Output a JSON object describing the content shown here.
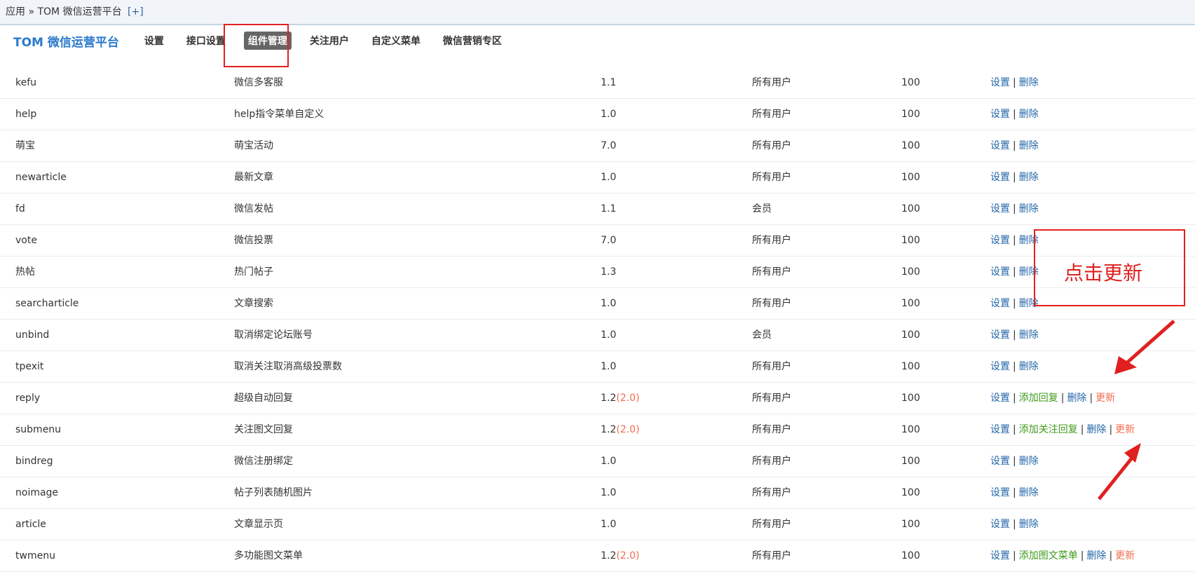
{
  "breadcrumb": {
    "app": "应用",
    "sep": "»",
    "platform": "TOM 微信运营平台",
    "add": "[+]"
  },
  "tabs": {
    "title": "TOM 微信运营平台",
    "items": [
      "设置",
      "接口设置",
      "组件管理",
      "关注用户",
      "自定义菜单",
      "微信营销专区"
    ],
    "active_index": 2
  },
  "annotation": {
    "note": "点击更新",
    "color": "#e02020"
  },
  "colors": {
    "link": "#2366a8",
    "green_link": "#3f9a1b",
    "orange": "#f26c4f",
    "title_blue": "#2b7acd"
  },
  "rows": [
    {
      "id": "kefu",
      "name": "微信多客服",
      "ver": "1.1",
      "ver_update": "",
      "role": "所有用户",
      "num": "100",
      "actions": [
        "设置",
        "删除"
      ]
    },
    {
      "id": "help",
      "name": "help指令菜单自定义",
      "ver": "1.0",
      "ver_update": "",
      "role": "所有用户",
      "num": "100",
      "actions": [
        "设置",
        "删除"
      ]
    },
    {
      "id": "萌宝",
      "name": "萌宝活动",
      "ver": "7.0",
      "ver_update": "",
      "role": "所有用户",
      "num": "100",
      "actions": [
        "设置",
        "删除"
      ]
    },
    {
      "id": "newarticle",
      "name": "最新文章",
      "ver": "1.0",
      "ver_update": "",
      "role": "所有用户",
      "num": "100",
      "actions": [
        "设置",
        "删除"
      ]
    },
    {
      "id": "fd",
      "name": "微信发帖",
      "ver": "1.1",
      "ver_update": "",
      "role": "会员",
      "num": "100",
      "actions": [
        "设置",
        "删除"
      ]
    },
    {
      "id": "vote",
      "name": "微信投票",
      "ver": "7.0",
      "ver_update": "",
      "role": "所有用户",
      "num": "100",
      "actions": [
        "设置",
        "删除"
      ]
    },
    {
      "id": "热帖",
      "name": "热门帖子",
      "ver": "1.3",
      "ver_update": "",
      "role": "所有用户",
      "num": "100",
      "actions": [
        "设置",
        "删除"
      ]
    },
    {
      "id": "searcharticle",
      "name": "文章搜索",
      "ver": "1.0",
      "ver_update": "",
      "role": "所有用户",
      "num": "100",
      "actions": [
        "设置",
        "删除"
      ]
    },
    {
      "id": "unbind",
      "name": "取消绑定论坛账号",
      "ver": "1.0",
      "ver_update": "",
      "role": "会员",
      "num": "100",
      "actions": [
        "设置",
        "删除"
      ]
    },
    {
      "id": "tpexit",
      "name": "取消关注取消高级投票数",
      "ver": "1.0",
      "ver_update": "",
      "role": "所有用户",
      "num": "100",
      "actions": [
        "设置",
        "删除"
      ]
    },
    {
      "id": "reply",
      "name": "超级自动回复",
      "ver": "1.2",
      "ver_update": "(2.0)",
      "role": "所有用户",
      "num": "100",
      "actions": [
        "设置",
        "添加回复",
        "删除",
        "更新"
      ]
    },
    {
      "id": "submenu",
      "name": "关注图文回复",
      "ver": "1.2",
      "ver_update": "(2.0)",
      "role": "所有用户",
      "num": "100",
      "actions": [
        "设置",
        "添加关注回复",
        "删除",
        "更新"
      ]
    },
    {
      "id": "bindreg",
      "name": "微信注册绑定",
      "ver": "1.0",
      "ver_update": "",
      "role": "所有用户",
      "num": "100",
      "actions": [
        "设置",
        "删除"
      ]
    },
    {
      "id": "noimage",
      "name": "帖子列表随机图片",
      "ver": "1.0",
      "ver_update": "",
      "role": "所有用户",
      "num": "100",
      "actions": [
        "设置",
        "删除"
      ]
    },
    {
      "id": "article",
      "name": "文章显示页",
      "ver": "1.0",
      "ver_update": "",
      "role": "所有用户",
      "num": "100",
      "actions": [
        "设置",
        "删除"
      ]
    },
    {
      "id": "twmenu",
      "name": "多功能图文菜单",
      "ver": "1.2",
      "ver_update": "(2.0)",
      "role": "所有用户",
      "num": "100",
      "actions": [
        "设置",
        "添加图文菜单",
        "删除",
        "更新"
      ]
    }
  ]
}
